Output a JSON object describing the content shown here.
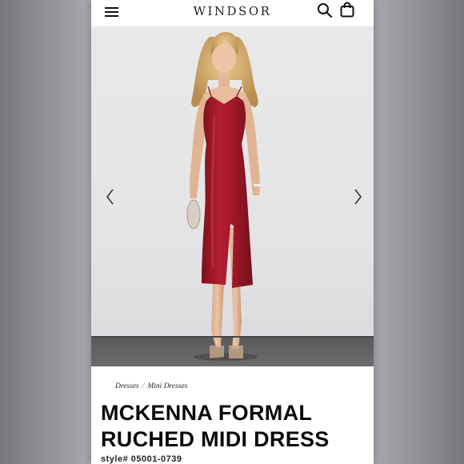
{
  "header": {
    "logo": "WINDSOR",
    "icons": [
      "menu-icon",
      "search-icon",
      "shopping-bag-icon"
    ]
  },
  "gallery": {
    "image": "model-wearing-red-satin-midi-dress",
    "nav_icons": [
      "chevron-left-icon",
      "chevron-right-icon"
    ]
  },
  "breadcrumb": {
    "items": [
      "Dresses",
      "Mini Dresses"
    ],
    "separator": "/"
  },
  "product": {
    "title": "MCKENNA FORMAL RUCHED MIDI DRESS",
    "style_number": "style# 05001-0739"
  },
  "colors": {
    "dress": "#a3182a",
    "backdrop": "#e6e6e8",
    "floor": "#5e5e61"
  }
}
